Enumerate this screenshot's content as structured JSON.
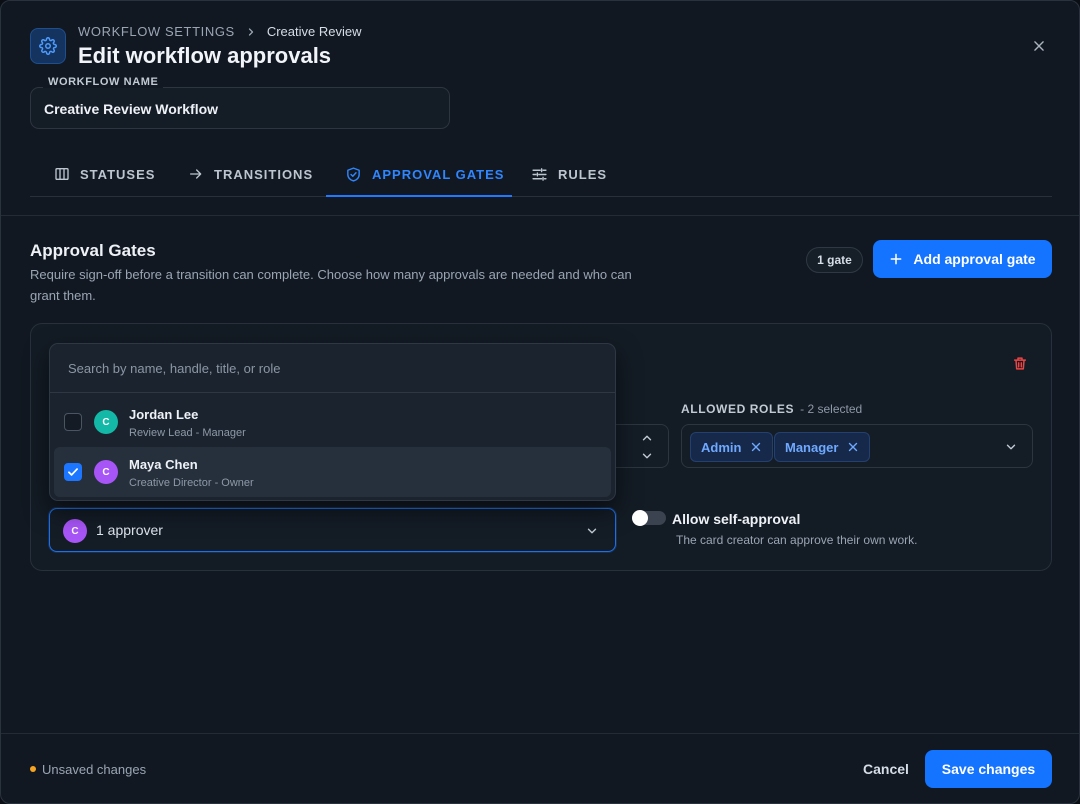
{
  "header": {
    "breadcrumb_parent": "WORKFLOW SETTINGS",
    "breadcrumb_current": "Creative Review",
    "title": "Edit workflow approvals",
    "header_icon": "gear-icon",
    "close_icon": "close-icon"
  },
  "workflow_name": {
    "label": "WORKFLOW NAME",
    "value": "Creative Review Workflow"
  },
  "tabs": [
    {
      "label": "STATUSES",
      "icon": "columns-icon",
      "active": false
    },
    {
      "label": "TRANSITIONS",
      "icon": "arrow-right-icon",
      "active": false
    },
    {
      "label": "APPROVAL GATES",
      "icon": "shield-check-icon",
      "active": true
    },
    {
      "label": "RULES",
      "icon": "sliders-icon",
      "active": false
    }
  ],
  "section": {
    "title": "Approval Gates",
    "description": "Require sign-off before a transition can complete. Choose how many approvals are needed and who can grant them.",
    "gate_count": "1 gate",
    "add_button": "Add approval gate"
  },
  "gate": {
    "roles_label": "ALLOWED ROLES",
    "roles_count": "- 2 selected",
    "roles": [
      "Admin",
      "Manager"
    ],
    "approver_avatar": "C",
    "approver_summary": "1 approver",
    "self_approval_label": "Allow self-approval",
    "self_approval_desc": "The card creator can approve their own work.",
    "self_approval_enabled": false
  },
  "dropdown": {
    "search_placeholder": "Search by name, handle, title, or role",
    "options": [
      {
        "name": "Jordan Lee",
        "subtitle": "Review Lead - Manager",
        "avatar": "C",
        "checked": false
      },
      {
        "name": "Maya Chen",
        "subtitle": "Creative Director - Owner",
        "avatar": "C",
        "checked": true
      }
    ]
  },
  "footer": {
    "status": "Unsaved changes",
    "cancel": "Cancel",
    "save": "Save changes"
  },
  "colors": {
    "accent": "#1473ff",
    "danger": "#ef4444",
    "warning": "#f5a524",
    "avatar_teal": "#14b8a6",
    "avatar_purple": "#a855f7"
  }
}
